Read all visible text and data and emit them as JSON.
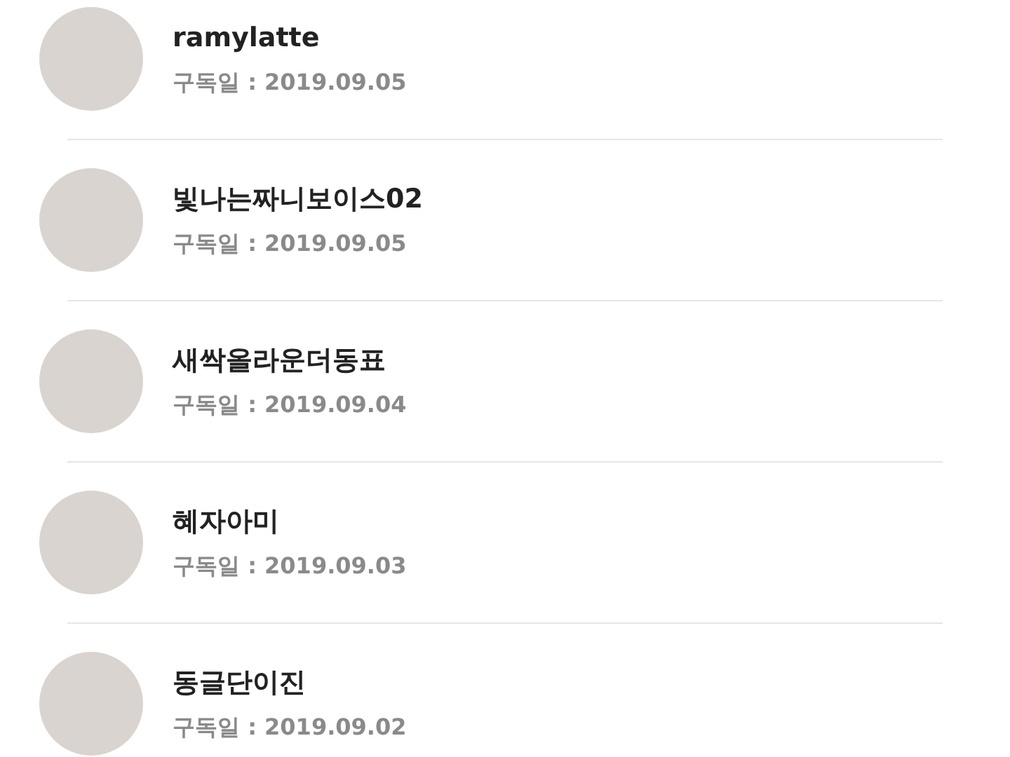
{
  "subscribers": [
    {
      "name": "ramylatte",
      "subscribed": "구독일 : 2019.09.05"
    },
    {
      "name": "빛나는짜니보이스02",
      "subscribed": "구독일 : 2019.09.05"
    },
    {
      "name": "새싹올라운더동표",
      "subscribed": "구독일 : 2019.09.04"
    },
    {
      "name": "혜자아미",
      "subscribed": "구독일 : 2019.09.03"
    },
    {
      "name": "동글단이진",
      "subscribed": "구독일 : 2019.09.02"
    }
  ]
}
